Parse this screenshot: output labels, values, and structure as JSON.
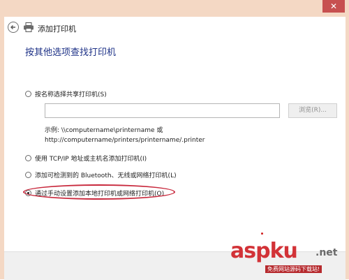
{
  "window": {
    "close_glyph": "✕",
    "title": "添加打印机"
  },
  "main": {
    "heading": "按其他选项查找打印机",
    "options": [
      {
        "label": "按名称选择共享打印机(S)",
        "checked": false
      },
      {
        "label": "使用 TCP/IP 地址或主机名添加打印机(I)",
        "checked": false
      },
      {
        "label": "添加可检测到的 Bluetooth、无线或网络打印机(L)",
        "checked": false
      },
      {
        "label": "通过手动设置添加本地打印机或网络打印机(O)",
        "checked": true
      }
    ],
    "shared_printer_input": {
      "value": "",
      "placeholder": ""
    },
    "browse_label": "浏览(R)...",
    "example_line1": "示例: \\\\computername\\printername 或",
    "example_line2": "http://computername/printers/printername/.printer"
  },
  "watermark": {
    "brand": "aspku",
    "tld": ".net",
    "tagline": "免费网站源码下载站!"
  },
  "colors": {
    "frame": "#f4d8c4",
    "close_button": "#c75050",
    "heading": "#1e3287",
    "highlight": "#c8283c",
    "watermark": "#d23237"
  },
  "icons": [
    "back-arrow-icon",
    "printer-icon",
    "close-icon"
  ]
}
